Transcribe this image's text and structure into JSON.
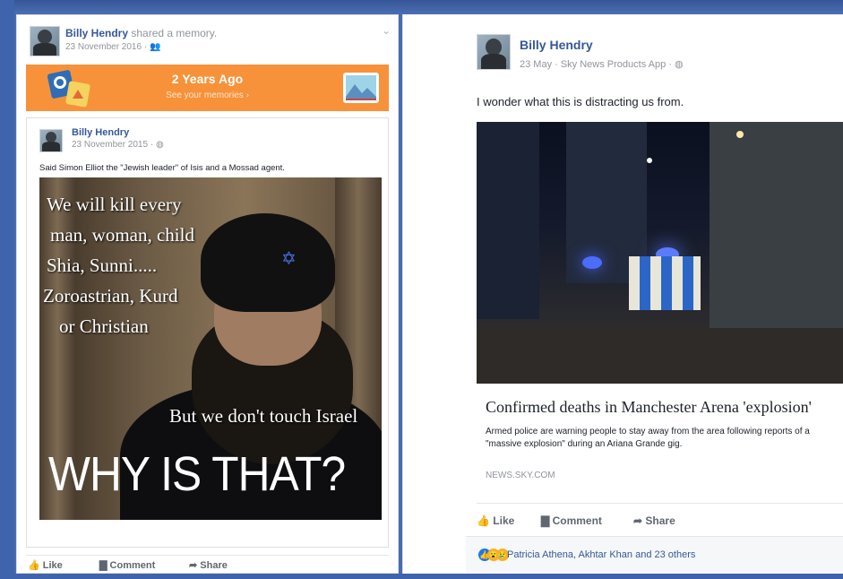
{
  "memory_card": {
    "author": "Billy Hendry",
    "action": "shared a memory.",
    "date": "23 November 2016 · ",
    "audience_icon": "friends-icon",
    "banner": {
      "title": "2 Years Ago",
      "subtitle": "See your memories ›"
    },
    "shared_post": {
      "author": "Billy Hendry",
      "date": "23 November 2015 · ",
      "privacy_icon": "globe-icon",
      "text": "Said Simon Elliot the \"Jewish leader\" of Isis and a Mossad agent.",
      "meme_lines": [
        "We will kill every",
        "man, woman, child",
        "Shia, Sunni.....",
        "Zoroastrian, Kurd",
        "or Christian",
        "But we don't touch Israel"
      ],
      "meme_big": "WHY IS THAT?"
    },
    "actions": {
      "like": "Like",
      "comment": "Comment",
      "share": "Share"
    }
  },
  "news_card": {
    "author": "Billy Hendry",
    "date": "23 May · Sky News Products App · ",
    "privacy_icon": "globe-icon",
    "text": "I wonder what this is distracting us from.",
    "link": {
      "title": "Confirmed deaths in Manchester Arena 'explosion'",
      "description_line1": "Armed police are warning people to stay away from the area following reports of a",
      "description_line2": "\"massive explosion\" during an Ariana Grande gig.",
      "domain": "NEWS.SKY.COM"
    },
    "actions": {
      "like": "Like",
      "comment": "Comment",
      "share": "Share"
    },
    "reactions": {
      "text": "Patricia Athena, Akhtar Khan and 23 others",
      "icons": [
        "like-reaction-icon",
        "wow-reaction-icon",
        "sad-reaction-icon"
      ]
    }
  },
  "colors": {
    "frame": "#4a6cb0",
    "link_blue": "#365899",
    "memory_orange": "#f7923a"
  }
}
